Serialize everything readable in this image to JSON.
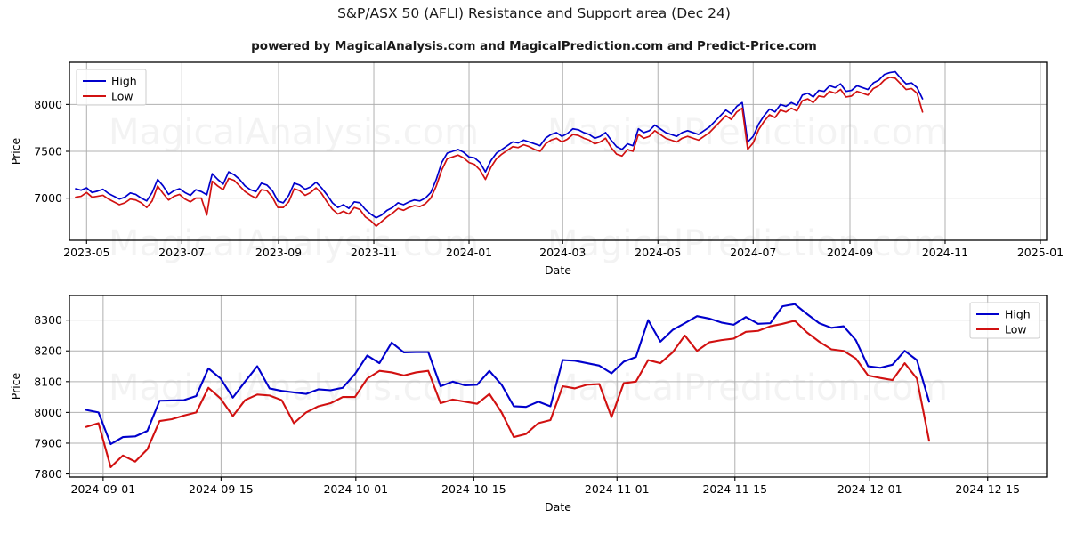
{
  "header": {
    "title": "S&P/ASX 50 (AFLI) Resistance and Support area (Dec 24)",
    "subtitle": "powered by MagicalAnalysis.com and MagicalPrediction.com and Predict-Price.com"
  },
  "watermarks": [
    "MagicalAnalysis.com",
    "MagicalPrediction.com"
  ],
  "colors": {
    "high": "#0000cc",
    "low": "#d11111",
    "grid": "#b0b0b0",
    "axis": "#000000"
  },
  "chart_data": [
    {
      "id": "overview",
      "type": "line",
      "title": "S&P/ASX 50 (AFLI) Resistance and Support area (Dec 24)",
      "xlabel": "Date",
      "ylabel": "Price",
      "grid": true,
      "legend_position": "upper left",
      "xlim": [
        "2023-04-20",
        "2025-01-05"
      ],
      "ylim": [
        6550,
        8450
      ],
      "yticks": [
        7000,
        7500,
        8000
      ],
      "xticks": [
        "2023-05",
        "2023-07",
        "2023-09",
        "2023-11",
        "2024-01",
        "2024-03",
        "2024-05",
        "2024-07",
        "2024-09",
        "2024-11",
        "2025-01"
      ],
      "x_start": "2023-04-24",
      "x_step_days": 3.5,
      "series": [
        {
          "name": "High",
          "color": "#0000cc",
          "values": [
            7100,
            7085,
            7110,
            7060,
            7075,
            7095,
            7050,
            7020,
            6990,
            7010,
            7055,
            7040,
            7000,
            6970,
            7060,
            7200,
            7130,
            7040,
            7080,
            7100,
            7060,
            7030,
            7090,
            7070,
            7035,
            7260,
            7200,
            7150,
            7280,
            7250,
            7200,
            7130,
            7090,
            7070,
            7160,
            7140,
            7080,
            6970,
            6950,
            7030,
            7160,
            7140,
            7095,
            7120,
            7170,
            7110,
            7035,
            6950,
            6900,
            6930,
            6890,
            6960,
            6950,
            6880,
            6830,
            6790,
            6820,
            6870,
            6900,
            6950,
            6930,
            6960,
            6980,
            6970,
            7000,
            7060,
            7200,
            7380,
            7480,
            7500,
            7520,
            7490,
            7440,
            7430,
            7380,
            7280,
            7400,
            7480,
            7520,
            7560,
            7600,
            7590,
            7620,
            7600,
            7580,
            7560,
            7640,
            7680,
            7700,
            7660,
            7690,
            7740,
            7730,
            7700,
            7680,
            7640,
            7660,
            7700,
            7620,
            7550,
            7520,
            7580,
            7560,
            7740,
            7700,
            7720,
            7780,
            7740,
            7700,
            7680,
            7660,
            7700,
            7720,
            7700,
            7680,
            7720,
            7760,
            7820,
            7880,
            7940,
            7900,
            7980,
            8020,
            7600,
            7660,
            7790,
            7880,
            7950,
            7920,
            8000,
            7980,
            8020,
            7990,
            8100,
            8120,
            8080,
            8150,
            8140,
            8200,
            8180,
            8220,
            8140,
            8150,
            8200,
            8180,
            8160,
            8230,
            8260,
            8320,
            8340,
            8350,
            8280,
            8220,
            8230,
            8180,
            8060
          ]
        },
        {
          "name": "Low",
          "color": "#d11111",
          "values": [
            7010,
            7020,
            7060,
            7010,
            7020,
            7030,
            6990,
            6960,
            6930,
            6950,
            6990,
            6980,
            6950,
            6900,
            6970,
            7130,
            7050,
            6980,
            7020,
            7040,
            6990,
            6960,
            7000,
            7000,
            6820,
            7180,
            7130,
            7090,
            7210,
            7190,
            7130,
            7070,
            7030,
            7000,
            7090,
            7080,
            7010,
            6900,
            6900,
            6960,
            7100,
            7080,
            7030,
            7060,
            7110,
            7050,
            6960,
            6880,
            6830,
            6860,
            6830,
            6900,
            6880,
            6800,
            6760,
            6700,
            6750,
            6800,
            6840,
            6890,
            6870,
            6900,
            6920,
            6910,
            6940,
            7000,
            7130,
            7300,
            7420,
            7440,
            7460,
            7430,
            7380,
            7360,
            7300,
            7200,
            7330,
            7420,
            7470,
            7510,
            7550,
            7540,
            7570,
            7550,
            7520,
            7500,
            7580,
            7620,
            7640,
            7600,
            7630,
            7680,
            7670,
            7640,
            7620,
            7580,
            7600,
            7640,
            7540,
            7470,
            7450,
            7520,
            7500,
            7680,
            7640,
            7660,
            7720,
            7680,
            7640,
            7620,
            7600,
            7640,
            7660,
            7640,
            7620,
            7660,
            7700,
            7760,
            7820,
            7880,
            7840,
            7920,
            7960,
            7520,
            7590,
            7730,
            7820,
            7890,
            7860,
            7940,
            7920,
            7960,
            7930,
            8040,
            8060,
            8020,
            8090,
            8080,
            8140,
            8120,
            8160,
            8080,
            8090,
            8140,
            8120,
            8100,
            8170,
            8200,
            8260,
            8290,
            8280,
            8220,
            8160,
            8170,
            8120,
            7920
          ]
        }
      ]
    },
    {
      "id": "detail",
      "type": "line",
      "xlabel": "Date",
      "ylabel": "Price",
      "grid": true,
      "legend_position": "upper right",
      "xlim": [
        "2024-08-28",
        "2024-12-22"
      ],
      "ylim": [
        7790,
        8380
      ],
      "yticks": [
        7800,
        7900,
        8000,
        8100,
        8200,
        8300
      ],
      "xticks": [
        "2024-09-01",
        "2024-09-15",
        "2024-10-01",
        "2024-10-15",
        "2024-11-01",
        "2024-11-15",
        "2024-12-01",
        "2024-12-15"
      ],
      "x_start": "2024-08-30",
      "x_step_days": 1.45,
      "series": [
        {
          "name": "High",
          "color": "#0000cc",
          "values": [
            8008,
            8000,
            7897,
            7920,
            7922,
            7940,
            8038,
            8039,
            8040,
            8053,
            8143,
            8110,
            8048,
            8100,
            8150,
            8078,
            8070,
            8065,
            8060,
            8075,
            8072,
            8080,
            8125,
            8185,
            8160,
            8227,
            8195,
            8196,
            8196,
            8085,
            8100,
            8088,
            8090,
            8135,
            8090,
            8020,
            8018,
            8035,
            8020,
            8170,
            8168,
            8160,
            8152,
            8127,
            8165,
            8180,
            8300,
            8230,
            8268,
            8290,
            8313,
            8305,
            8292,
            8285,
            8310,
            8288,
            8290,
            8345,
            8352,
            8320,
            8290,
            8275,
            8280,
            8235,
            8150,
            8145,
            8155,
            8200,
            8170,
            8035
          ]
        },
        {
          "name": "Low",
          "color": "#d11111",
          "values": [
            7953,
            7965,
            7822,
            7860,
            7840,
            7880,
            7972,
            7978,
            7990,
            8000,
            8080,
            8045,
            7988,
            8040,
            8058,
            8055,
            8040,
            7965,
            8000,
            8020,
            8030,
            8050,
            8050,
            8110,
            8135,
            8130,
            8120,
            8130,
            8135,
            8030,
            8042,
            8035,
            8028,
            8060,
            8000,
            7920,
            7930,
            7965,
            7975,
            8085,
            8078,
            8090,
            8092,
            7985,
            8095,
            8100,
            8170,
            8160,
            8195,
            8250,
            8200,
            8228,
            8235,
            8240,
            8262,
            8265,
            8280,
            8288,
            8298,
            8260,
            8230,
            8205,
            8200,
            8175,
            8120,
            8112,
            8105,
            8160,
            8110,
            7908
          ]
        }
      ]
    }
  ]
}
